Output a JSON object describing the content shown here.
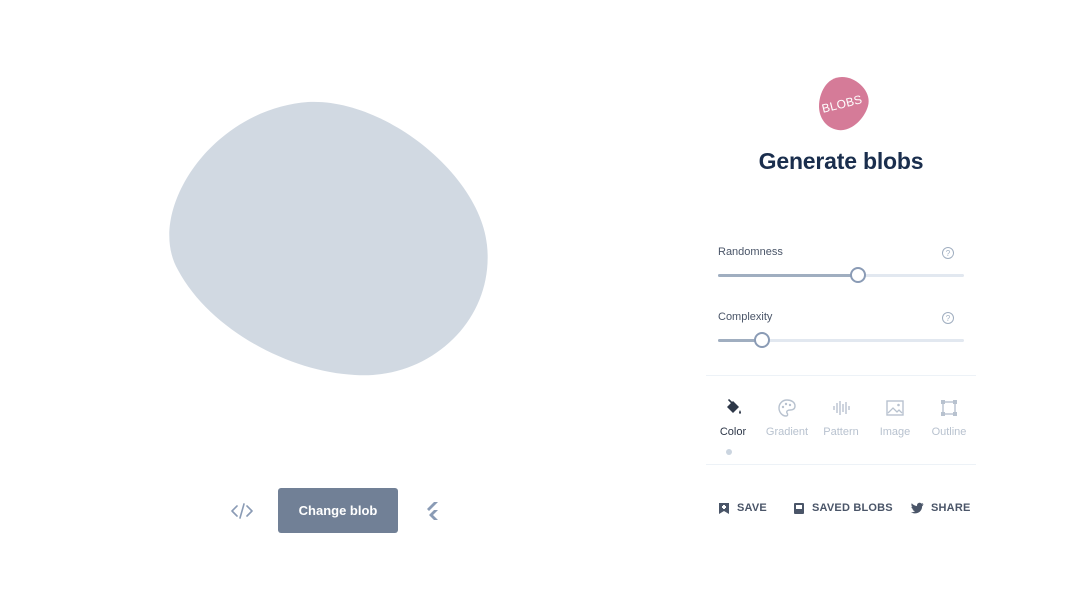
{
  "app": {
    "logo_text": "BLOBS",
    "title": "Generate blobs"
  },
  "colors": {
    "blob_fill": "#d1d9e2",
    "logo_fill": "#d57b98",
    "title": "#1a2e4d",
    "button_bg": "#718096"
  },
  "canvas": {
    "change_blob_label": "Change blob",
    "code_icon": "code-icon",
    "flutter_icon": "flutter-icon"
  },
  "sliders": {
    "randomness": {
      "label": "Randomness",
      "value": 0.57
    },
    "complexity": {
      "label": "Complexity",
      "value": 0.18
    }
  },
  "tabs": [
    {
      "label": "Color",
      "icon": "paint-bucket-icon",
      "active": true
    },
    {
      "label": "Gradient",
      "icon": "palette-icon",
      "active": false
    },
    {
      "label": "Pattern",
      "icon": "pattern-bars-icon",
      "active": false
    },
    {
      "label": "Image",
      "icon": "image-icon",
      "active": false
    },
    {
      "label": "Outline",
      "icon": "outline-square-icon",
      "active": false
    }
  ],
  "footer": {
    "save_label": "SAVE",
    "saved_blobs_label": "SAVED BLOBS",
    "share_label": "SHARE"
  }
}
